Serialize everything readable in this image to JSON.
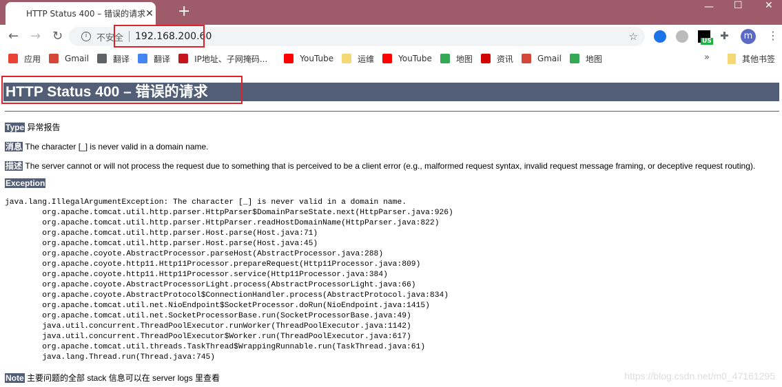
{
  "browser": {
    "tab_title": "HTTP Status 400 – 错误的请求",
    "security_label": "不安全",
    "url": "192.168.200.60",
    "profile_initial": "m",
    "extension_badge": "US",
    "bookmarks": [
      {
        "label": "应用",
        "icon": "apps-grid-icon",
        "color": "#ea4335"
      },
      {
        "label": "Gmail",
        "icon": "gmail-icon",
        "color": "#d44638"
      },
      {
        "label": "翻译",
        "icon": "globe-icon",
        "color": "#5f6368"
      },
      {
        "label": "翻译",
        "icon": "google-translate-icon",
        "color": "#4285f4"
      },
      {
        "label": "IP地址、子网掩码...",
        "icon": "c-logo-icon",
        "color": "#c4151c"
      },
      {
        "label": "YouTube",
        "icon": "youtube-icon",
        "color": "#ff0000"
      },
      {
        "label": "运维",
        "icon": "folder-icon",
        "color": "#f6d776"
      },
      {
        "label": "YouTube",
        "icon": "youtube-icon",
        "color": "#ff0000"
      },
      {
        "label": "地图",
        "icon": "maps-icon",
        "color": "#34a853"
      },
      {
        "label": "资讯",
        "icon": "dongfang-icon",
        "color": "#d00000"
      },
      {
        "label": "Gmail",
        "icon": "gmail-icon",
        "color": "#d44638"
      },
      {
        "label": "地图",
        "icon": "maps-icon",
        "color": "#34a853"
      }
    ],
    "overflow": "»",
    "other_bookmarks": "其他书签"
  },
  "page": {
    "heading": "HTTP Status 400 – 错误的请求",
    "type_label": "Type",
    "type_value": "异常报告",
    "message_label": "消息",
    "message_value": "The character [_] is never valid in a domain name.",
    "desc_label": "描述",
    "desc_value": "The server cannot or will not process the request due to something that is perceived to be a client error (e.g., malformed request syntax, invalid request message framing, or deceptive request routing).",
    "exception_label": "Exception",
    "stack_trace": "java.lang.IllegalArgumentException: The character [_] is never valid in a domain name.\n\torg.apache.tomcat.util.http.parser.HttpParser$DomainParseState.next(HttpParser.java:926)\n\torg.apache.tomcat.util.http.parser.HttpParser.readHostDomainName(HttpParser.java:822)\n\torg.apache.tomcat.util.http.parser.Host.parse(Host.java:71)\n\torg.apache.tomcat.util.http.parser.Host.parse(Host.java:45)\n\torg.apache.coyote.AbstractProcessor.parseHost(AbstractProcessor.java:288)\n\torg.apache.coyote.http11.Http11Processor.prepareRequest(Http11Processor.java:809)\n\torg.apache.coyote.http11.Http11Processor.service(Http11Processor.java:384)\n\torg.apache.coyote.AbstractProcessorLight.process(AbstractProcessorLight.java:66)\n\torg.apache.coyote.AbstractProtocol$ConnectionHandler.process(AbstractProtocol.java:834)\n\torg.apache.tomcat.util.net.NioEndpoint$SocketProcessor.doRun(NioEndpoint.java:1415)\n\torg.apache.tomcat.util.net.SocketProcessorBase.run(SocketProcessorBase.java:49)\n\tjava.util.concurrent.ThreadPoolExecutor.runWorker(ThreadPoolExecutor.java:1142)\n\tjava.util.concurrent.ThreadPoolExecutor$Worker.run(ThreadPoolExecutor.java:617)\n\torg.apache.tomcat.util.threads.TaskThread$WrappingRunnable.run(TaskThread.java:61)\n\tjava.lang.Thread.run(Thread.java:745)",
    "note_label": "Note",
    "note_value": "主要问题的全部 stack 信息可以在 server logs 里查看"
  },
  "watermark": "https://blog.csdn.net/m0_47161295",
  "colors": {
    "titlebar": "#9e5b69",
    "heading_bg": "#525D76",
    "annotation": "#e0202a"
  }
}
